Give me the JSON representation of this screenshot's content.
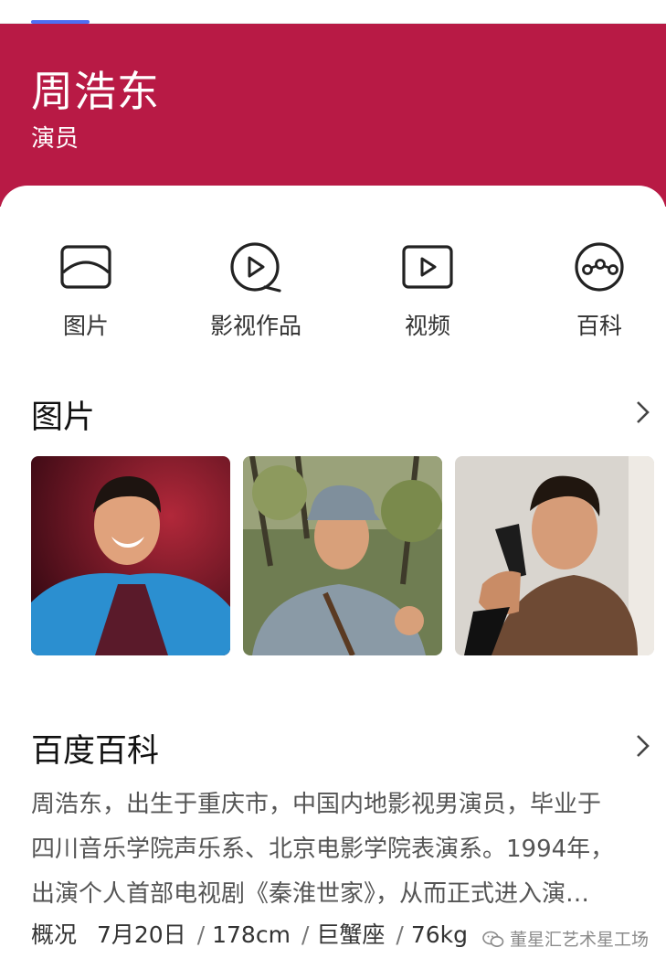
{
  "header": {
    "name": "周浩东",
    "role": "演员"
  },
  "nav": [
    {
      "label": "图片",
      "icon": "image-icon"
    },
    {
      "label": "影视作品",
      "icon": "film-play-icon"
    },
    {
      "label": "视频",
      "icon": "video-play-icon"
    },
    {
      "label": "百科",
      "icon": "encyclopedia-icon"
    }
  ],
  "photos_section": {
    "title": "图片",
    "photos": [
      {
        "alt": "stage-smiling-portrait"
      },
      {
        "alt": "military-uniform-portrait"
      },
      {
        "alt": "holding-pistol-portrait"
      }
    ]
  },
  "baike_section": {
    "title": "百度百科",
    "lines": [
      "周浩东，出生于重庆市，中国内地影视男演员，毕业于",
      "四川音乐学院声乐系、北京电影学院表演系。1994年，",
      "出演个人首部电视剧《秦淮世家》，从而正式进入演…"
    ],
    "facts_label": "概况",
    "facts": [
      "7月20日",
      "178cm",
      "巨蟹座",
      "76kg"
    ]
  },
  "watermark": "董星汇艺术星工场",
  "colors": {
    "hero": "#b81a45",
    "tab_indicator": "#4e6ef2"
  }
}
